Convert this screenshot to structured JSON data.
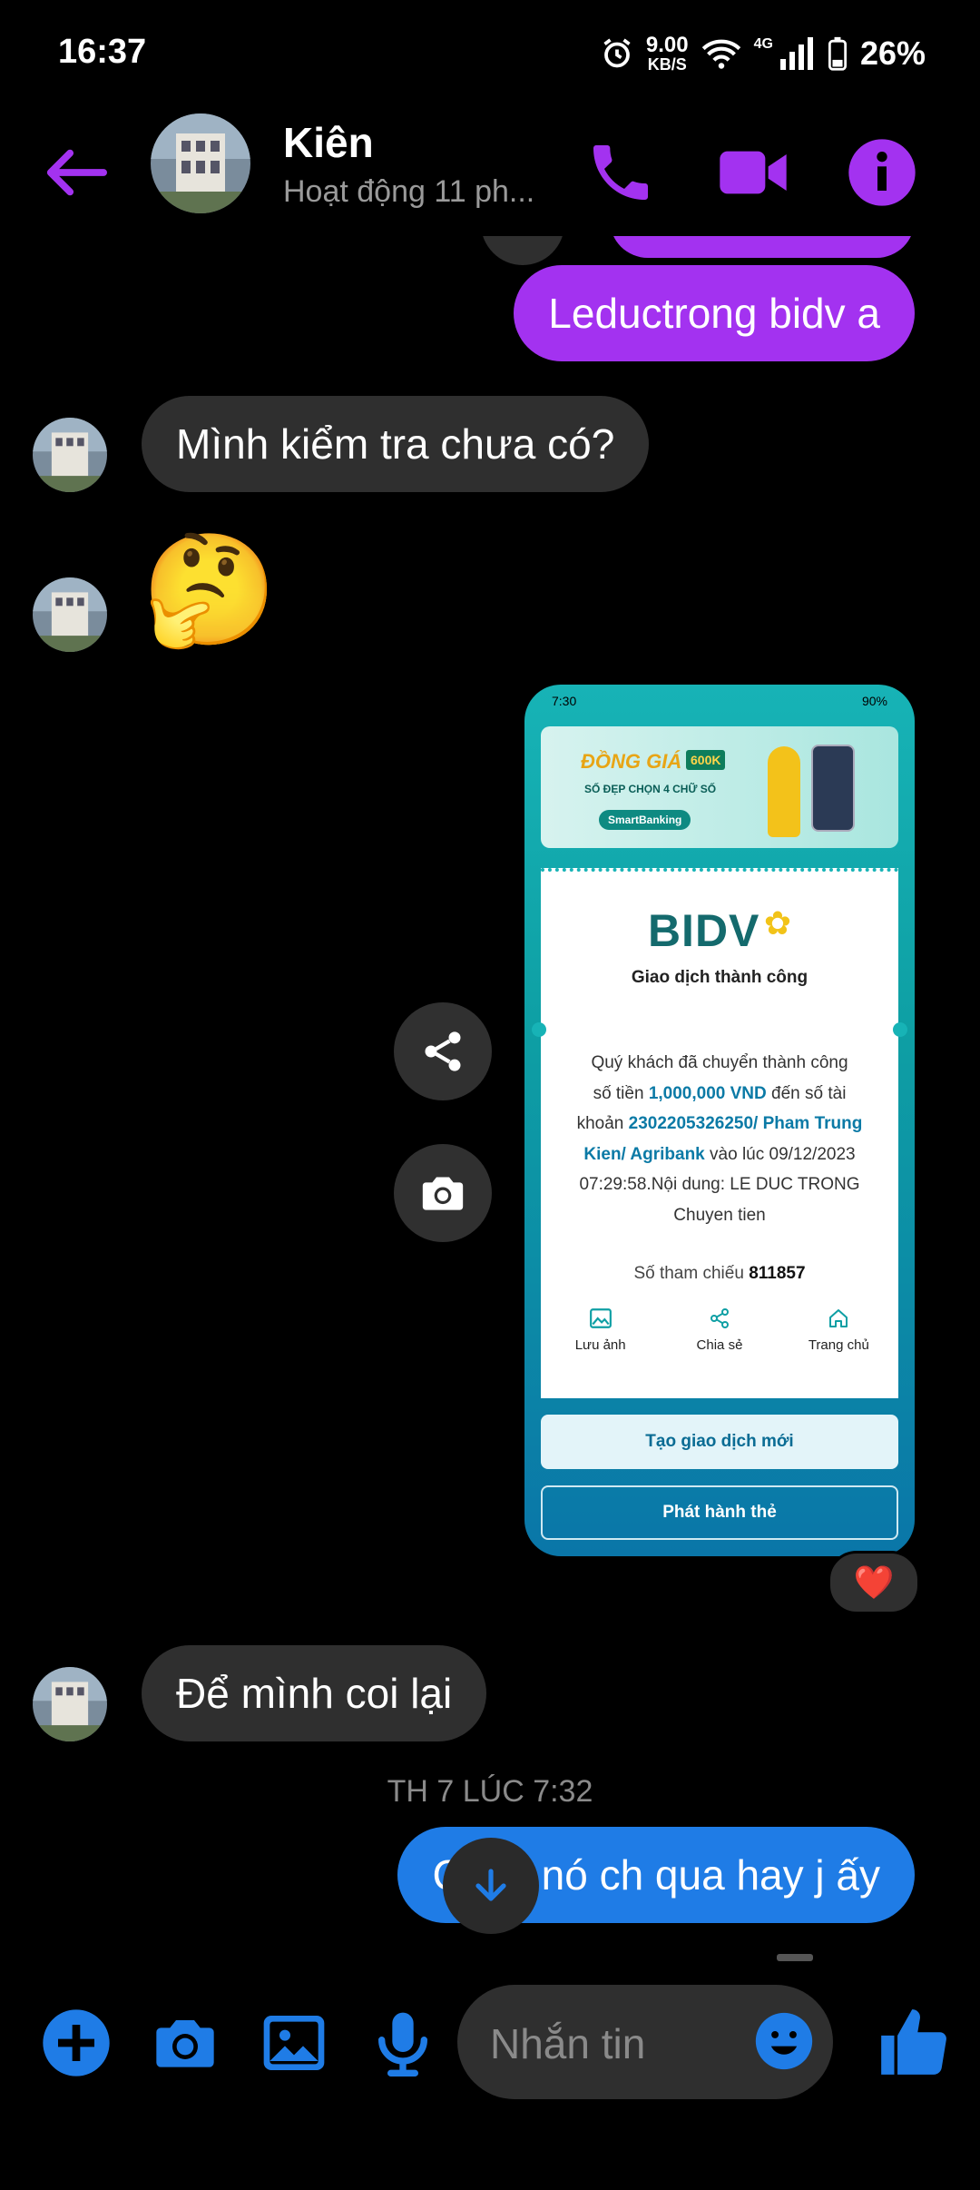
{
  "status": {
    "time": "16:37",
    "speed_value": "9.00",
    "speed_unit": "KB/S",
    "network": "4G",
    "battery": "26%"
  },
  "header": {
    "name": "Kiên",
    "presence": "Hoạt động 11 ph..."
  },
  "messages": {
    "m1": "Leductrong bidv a",
    "m2": "Mình kiểm tra chưa có?",
    "m3_emoji": "🤔",
    "m4": "Để mình coi lại",
    "timestamp": "TH 7 LÚC 7:32",
    "m5": "Chắc nó ch qua hay j ấy"
  },
  "receipt": {
    "status_time": "7:30",
    "status_right": "90%",
    "banner_title": "ĐỒNG GIÁ",
    "banner_price": "600K",
    "banner_sub": "SỐ ĐẸP CHỌN 4 CHỮ SỐ",
    "banner_app": "SmartBanking",
    "bank_logo": "BIDV",
    "success": "Giao dịch thành công",
    "line1": "Quý khách đã chuyển thành công",
    "line2a": "số tiền ",
    "amount": "1,000,000 VND",
    "line2b": " đến số tài",
    "line3a": "khoản ",
    "account": "2302205326250/ Pham Trung",
    "account2": "Kien/ Agribank",
    "line4b": " vào lúc 09/12/2023",
    "line5": "07:29:58.Nội dung: LE DUC TRONG",
    "line6": "Chuyen tien",
    "ref_label": "Số tham chiếu ",
    "ref_value": "811857",
    "actions": [
      "Lưu ảnh",
      "Chia sẻ",
      "Trang chủ"
    ],
    "btn_new": "Tạo giao dịch mới",
    "btn_card": "Phát hành thẻ"
  },
  "reaction": "❤️",
  "composer": {
    "placeholder": "Nhắn tin"
  },
  "colors": {
    "accent_purple": "#a332f0",
    "accent_blue": "#1f7ce6",
    "bidv_teal": "#0e9fa4"
  }
}
